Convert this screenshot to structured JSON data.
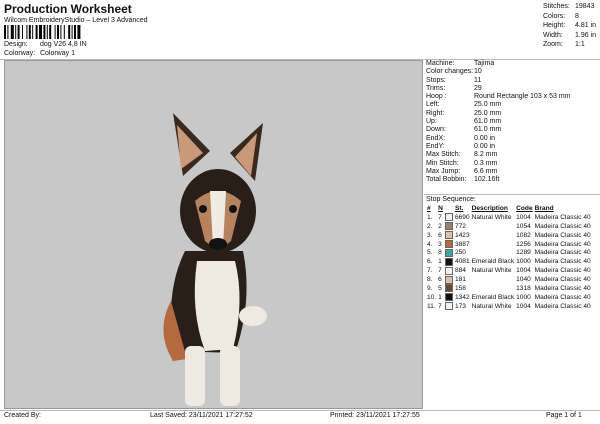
{
  "header": {
    "title": "Production Worksheet",
    "subtitle": "Wilcom EmbroideryStudio – Level 3 Advanced",
    "design_label": "Design:",
    "design_value": "dog V26 4,8 IN",
    "colorway_label": "Colorway:",
    "colorway_value": "Colorway 1"
  },
  "stats": [
    {
      "label": "Stitches:",
      "value": "19843"
    },
    {
      "label": "Colors:",
      "value": "8"
    },
    {
      "label": "Height:",
      "value": "4.81 in"
    },
    {
      "label": "Width:",
      "value": "1.96 in"
    },
    {
      "label": "Zoom:",
      "value": "1:1"
    }
  ],
  "machine_info": [
    {
      "label": "Machine:",
      "value": "Tajima"
    },
    {
      "label": "Color changes:",
      "value": "10"
    },
    {
      "label": "Stops:",
      "value": "11"
    },
    {
      "label": "Trims:",
      "value": "29"
    },
    {
      "label": "Hoop :",
      "value": "Round Rectangle 103 x 53 mm"
    },
    {
      "label": "Left:",
      "value": "25.0 mm"
    },
    {
      "label": "Right:",
      "value": "25.0 mm"
    },
    {
      "label": "Up:",
      "value": "61.0 mm"
    },
    {
      "label": "Down:",
      "value": "61.0 mm"
    },
    {
      "label": "EndX:",
      "value": "0.00 in"
    },
    {
      "label": "EndY:",
      "value": "0.00 in"
    },
    {
      "label": "Max Stitch:",
      "value": "8.2 mm"
    },
    {
      "label": "Min Stitch:",
      "value": "0.3 mm"
    },
    {
      "label": "Max Jump:",
      "value": "6.6 mm"
    },
    {
      "label": "Total Bobbin:",
      "value": "102.16ft"
    }
  ],
  "stop_sequence": {
    "label": "Stop Sequence:",
    "headers": [
      "#",
      "N",
      "St.",
      "Description",
      "Code",
      "Brand"
    ],
    "rows": [
      {
        "idx": "1.",
        "n": "7",
        "color": "#f2f2ee",
        "st": "6690",
        "desc": "Natural White",
        "code": "1004",
        "brand": "Madeira Classic 40"
      },
      {
        "idx": "2.",
        "n": "2",
        "color": "#a0806a",
        "st": "772",
        "desc": "",
        "code": "1054",
        "brand": "Madeira Classic 40"
      },
      {
        "idx": "3.",
        "n": "6",
        "color": "#d9c2a8",
        "st": "1423",
        "desc": "",
        "code": "1082",
        "brand": "Madeira Classic 40"
      },
      {
        "idx": "4.",
        "n": "3",
        "color": "#b56a3e",
        "st": "3887",
        "desc": "",
        "code": "1256",
        "brand": "Madeira Classic 40"
      },
      {
        "idx": "5.",
        "n": "8",
        "color": "#3aa8a0",
        "st": "250",
        "desc": "",
        "code": "1289",
        "brand": "Madeira Classic 40"
      },
      {
        "idx": "6.",
        "n": "1",
        "color": "#111111",
        "st": "4081",
        "desc": "Emerald Black",
        "code": "1000",
        "brand": "Madeira Classic 40"
      },
      {
        "idx": "7.",
        "n": "7",
        "color": "#f2f2ee",
        "st": "884",
        "desc": "Natural White",
        "code": "1004",
        "brand": "Madeira Classic 40"
      },
      {
        "idx": "8.",
        "n": "6",
        "color": "#d9c2a8",
        "st": "181",
        "desc": "",
        "code": "1040",
        "brand": "Madeira Classic 40"
      },
      {
        "idx": "9.",
        "n": "5",
        "color": "#6b4a35",
        "st": "158",
        "desc": "",
        "code": "1318",
        "brand": "Madeira Classic 40"
      },
      {
        "idx": "10.",
        "n": "1",
        "color": "#111111",
        "st": "1342",
        "desc": "Emerald Black",
        "code": "1000",
        "brand": "Madeira Classic 40"
      },
      {
        "idx": "11.",
        "n": "7",
        "color": "#f2f2ee",
        "st": "173",
        "desc": "Natural White",
        "code": "1004",
        "brand": "Madeira Classic 40"
      }
    ]
  },
  "footer": {
    "created_by": "Created By:",
    "last_saved": "Last Saved: 23/11/2021 17:27:52",
    "printed": "Printed: 23/11/2021 17:27:55",
    "page": "Page 1 of 1"
  }
}
